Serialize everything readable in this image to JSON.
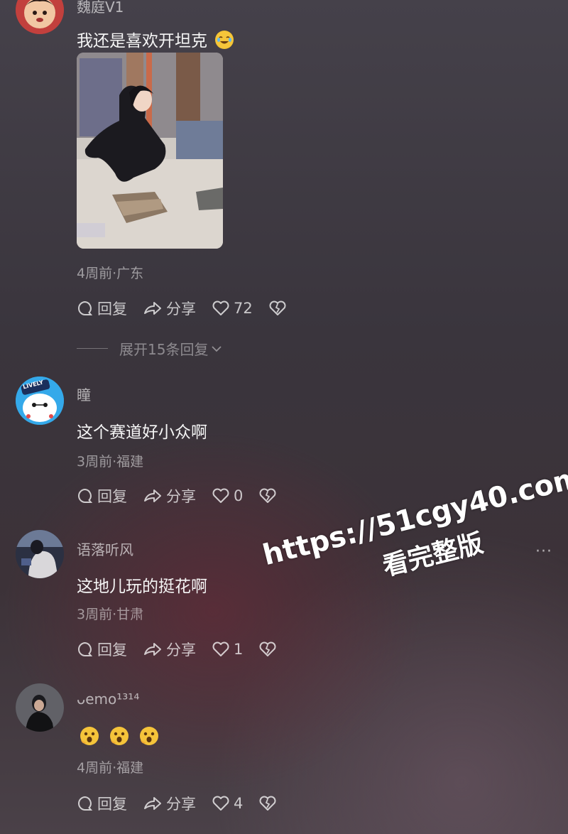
{
  "comments": [
    {
      "username": "魏庭V1",
      "text": "我还是喜欢开坦克",
      "meta": "4周前·广东",
      "reply_label": "回复",
      "share_label": "分享",
      "likes": "72",
      "expand_replies": "展开15条回复"
    },
    {
      "username": "瞳",
      "text": "这个赛道好小众啊",
      "meta": "3周前·福建",
      "reply_label": "回复",
      "share_label": "分享",
      "likes": "0",
      "avatar_badge": "LIVELY"
    },
    {
      "username": "语落听风",
      "text": "这地儿玩的挺花啊",
      "meta": "3周前·甘肃",
      "reply_label": "回复",
      "share_label": "分享",
      "likes": "1",
      "more_label": "···"
    },
    {
      "username": "ᴗemo¹³¹⁴",
      "text": "",
      "meta": "4周前·福建",
      "reply_label": "回复",
      "share_label": "分享",
      "likes": "4"
    }
  ],
  "watermark": {
    "url": "https://51cgy40.com",
    "subtitle": "看完整版"
  }
}
